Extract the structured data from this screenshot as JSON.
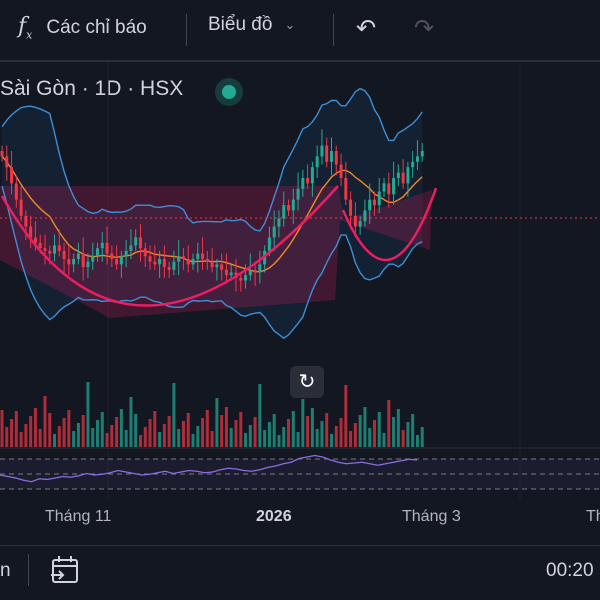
{
  "toolbar": {
    "indicators_icon": "fx-icon",
    "indicators_label": "Các chỉ báo",
    "chart_label": "Biểu đồ",
    "undo_icon": "undo-icon",
    "redo_icon": "redo-icon"
  },
  "legend": {
    "title": "Sài Gòn · 1D · HSX",
    "status_color": "#22ab94"
  },
  "time_axis": [
    "Tháng 11",
    "2026",
    "Tháng 3",
    "Th"
  ],
  "bottom": {
    "left_text": "n",
    "calendar_icon": "go-to-date-icon",
    "time": "00:20"
  },
  "colors": {
    "up": "#22ab94",
    "down": "#f23645",
    "bb": "#3d8fd8",
    "ma": "#f08a24",
    "rsi": "#8b6ee0",
    "pattern": "#e91e63"
  },
  "chart_data": {
    "type": "candlestick",
    "closes": [
      68,
      64,
      58,
      52,
      46,
      42,
      38,
      36,
      34,
      33,
      32,
      35,
      33,
      30,
      28,
      30,
      32,
      27,
      29,
      31,
      34,
      36,
      32,
      30,
      28,
      31,
      33,
      35,
      38,
      34,
      31,
      29,
      28,
      30,
      27,
      26,
      29,
      31,
      30,
      28,
      30,
      32,
      30,
      29,
      27,
      28,
      26,
      24,
      25,
      23,
      22,
      24,
      26,
      25,
      28,
      33,
      38,
      42,
      45,
      50,
      48,
      52,
      56,
      60,
      58,
      64,
      68,
      72,
      66,
      70,
      65,
      60,
      52,
      46,
      42,
      44,
      48,
      52,
      50,
      55,
      58,
      54,
      60,
      62,
      58,
      64,
      66,
      68,
      70
    ],
    "rsi": [
      40,
      38,
      36,
      33,
      31,
      35,
      34,
      36,
      38,
      37,
      39,
      42,
      40,
      41,
      43,
      46,
      44,
      42,
      40,
      41,
      43,
      45,
      42,
      44,
      46,
      45,
      43,
      44,
      47,
      49,
      48,
      46,
      45,
      47,
      50,
      52,
      55,
      57,
      62,
      64,
      66,
      64,
      60,
      57,
      55,
      56,
      57,
      55,
      53,
      55,
      57,
      59,
      61,
      60
    ]
  }
}
